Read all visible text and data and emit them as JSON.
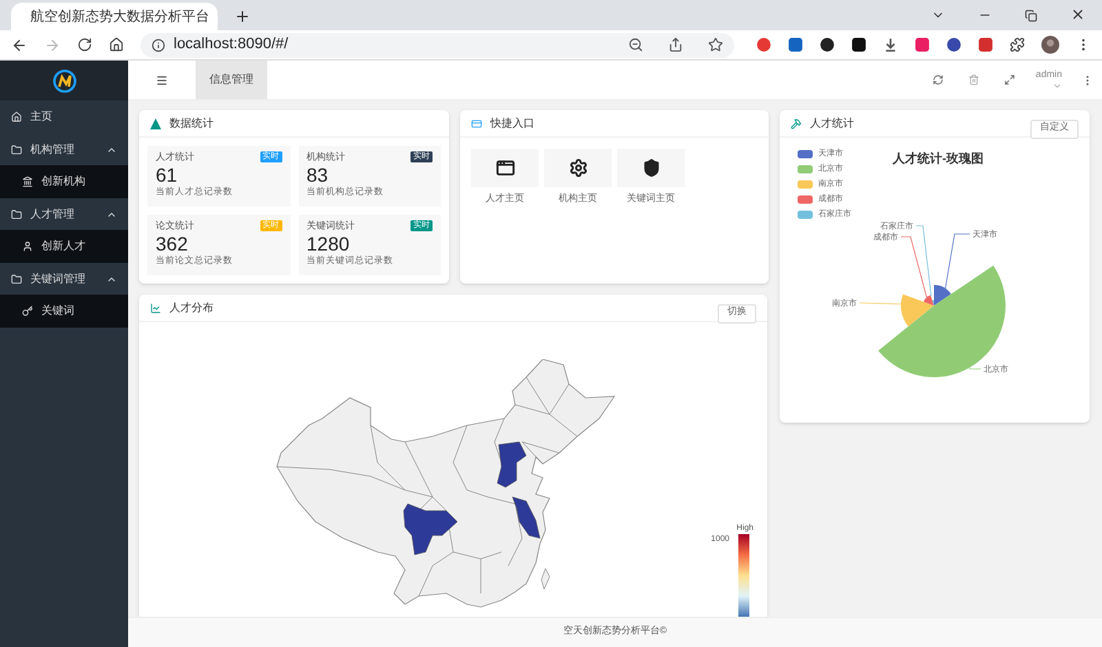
{
  "browser": {
    "tab_title": "航空创新态势大数据分析平台",
    "url": "localhost:8090/#/"
  },
  "sidebar": {
    "items": [
      {
        "label": "主页",
        "kind": "link"
      },
      {
        "label": "机构管理",
        "kind": "group",
        "expanded": true,
        "children": [
          {
            "label": "创新机构"
          }
        ]
      },
      {
        "label": "人才管理",
        "kind": "group",
        "expanded": true,
        "children": [
          {
            "label": "创新人才"
          }
        ]
      },
      {
        "label": "关键词管理",
        "kind": "group",
        "expanded": true,
        "children": [
          {
            "label": "关键词"
          }
        ]
      }
    ]
  },
  "header": {
    "tabs": [
      {
        "label": "信息管理",
        "selected": true
      }
    ],
    "user": "admin"
  },
  "stats_card": {
    "title": "数据统计",
    "items": [
      {
        "label": "人才统计",
        "badge": "实时",
        "color": "#1e9fff",
        "value": "61",
        "note": "当前人才总记录数"
      },
      {
        "label": "机构统计",
        "badge": "实时",
        "color": "#2f4056",
        "value": "83",
        "note": "当前机构总记录数"
      },
      {
        "label": "论文统计",
        "badge": "实时",
        "color": "#ffb800",
        "value": "362",
        "note": "当前论文总记录数"
      },
      {
        "label": "关键词统计",
        "badge": "实时",
        "color": "#009688",
        "value": "1280",
        "note": "当前关键词总记录数"
      }
    ]
  },
  "shortcuts": {
    "title": "快捷入口",
    "items": [
      {
        "label": "人才主页"
      },
      {
        "label": "机构主页"
      },
      {
        "label": "关键词主页"
      }
    ]
  },
  "talent_stats": {
    "title": "人才统计",
    "button": "自定义",
    "chart_title": "人才统计-玫瑰图",
    "legend": [
      {
        "name": "天津市",
        "color": "#5470c6"
      },
      {
        "name": "北京市",
        "color": "#91cc75"
      },
      {
        "name": "南京市",
        "color": "#fac858"
      },
      {
        "name": "成都市",
        "color": "#ee6666"
      },
      {
        "name": "石家庄市",
        "color": "#73c0de"
      }
    ],
    "slice_labels": [
      "天津市",
      "北京市",
      "南京市",
      "成都市",
      "石家庄市"
    ]
  },
  "map_card": {
    "title": "人才分布",
    "button": "切换",
    "scale_top": "High",
    "scale_max": "1000"
  },
  "footer": "空天创新态势分析平台©"
}
